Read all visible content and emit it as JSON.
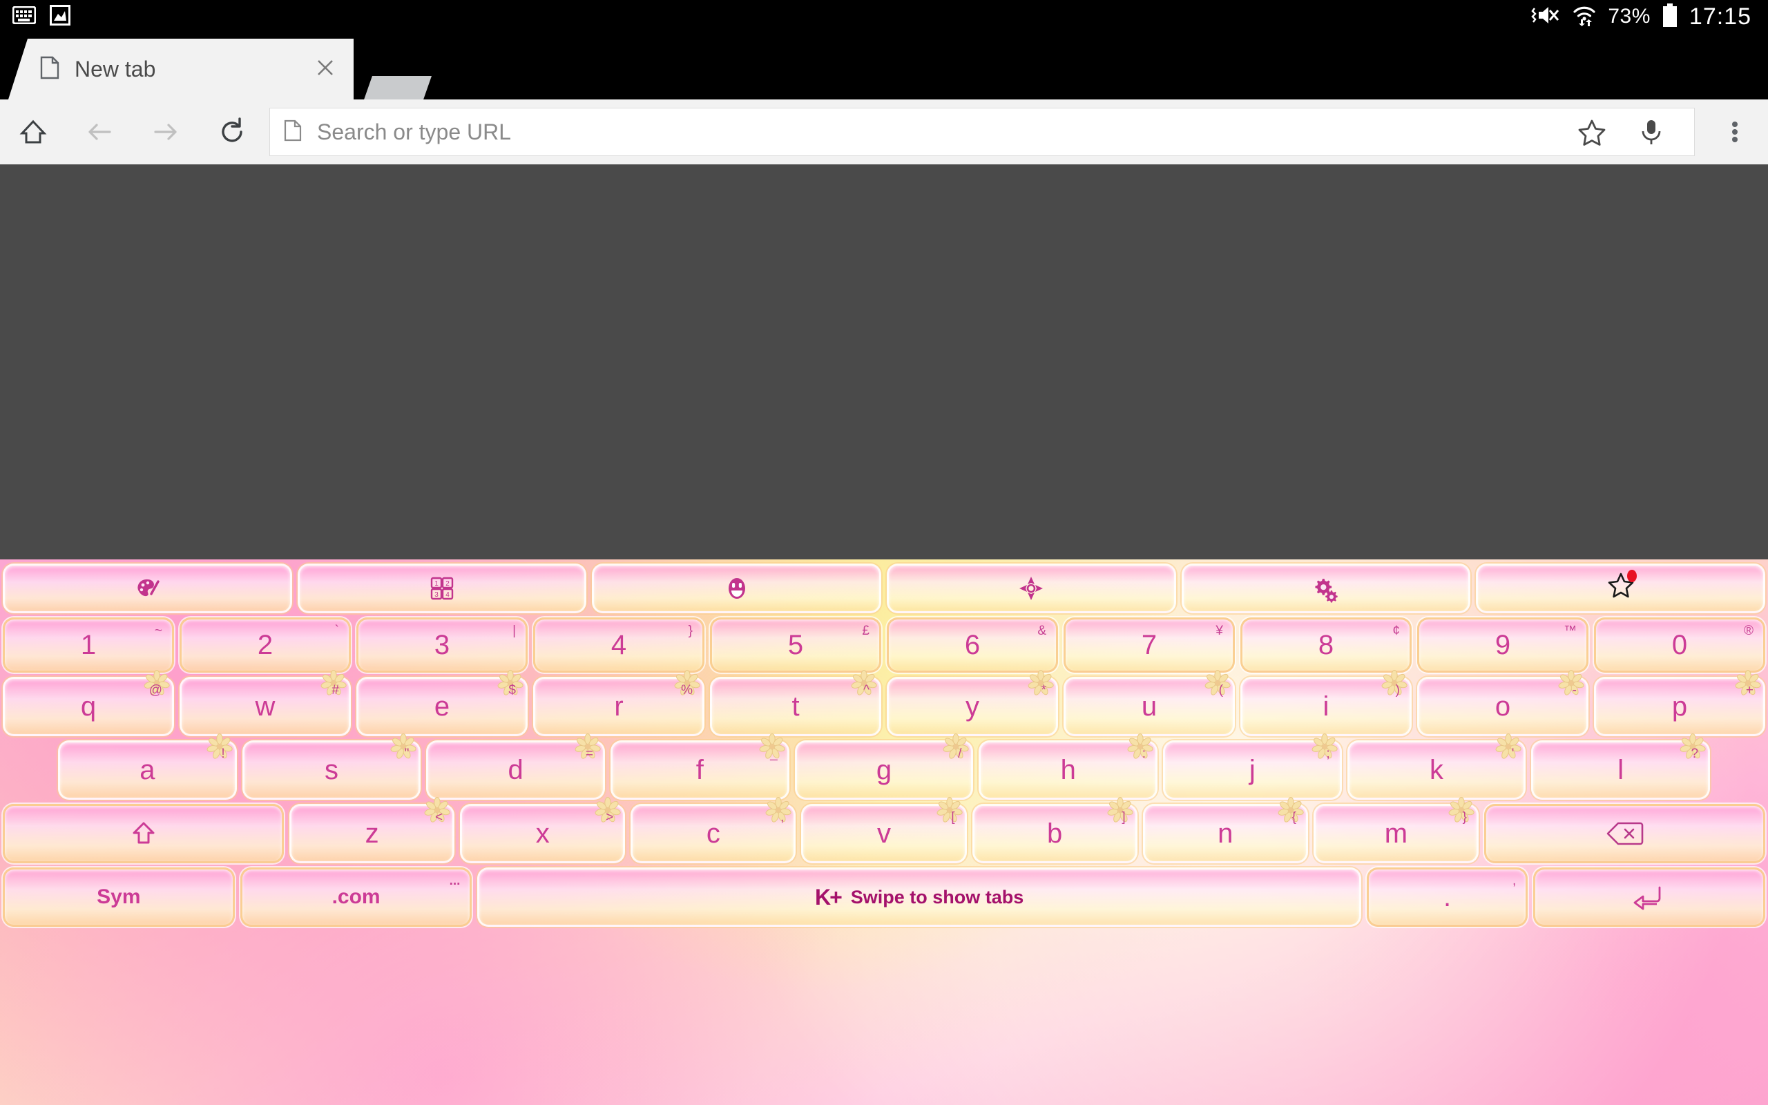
{
  "statusbar": {
    "left_icons": [
      "keyboard-icon",
      "image-icon"
    ],
    "battery_percent": "73%",
    "clock": "17:15",
    "right_icons": [
      "vibrate-mute-icon",
      "wifi-icon",
      "battery-icon"
    ]
  },
  "tabstrip": {
    "tabs": [
      {
        "title": "New tab",
        "favicon": "page-icon",
        "close": "close-icon",
        "active": true
      }
    ],
    "background_tab_present": true
  },
  "toolbar": {
    "home_label": "home-icon",
    "back_label": "back-arrow-icon",
    "forward_label": "forward-arrow-icon",
    "reload_label": "reload-icon",
    "omnibox": {
      "favicon": "page-icon",
      "placeholder": "Search or type URL",
      "value": "",
      "bookmark_icon": "star-icon",
      "voice_icon": "microphone-icon"
    },
    "menu_icon": "overflow-menu-icon"
  },
  "keyboard": {
    "function_row": [
      {
        "id": "theme",
        "icon": "palette-icon"
      },
      {
        "id": "numpad",
        "icon": "number-grid-icon"
      },
      {
        "id": "emoji",
        "icon": "smiley-icon"
      },
      {
        "id": "cursor",
        "icon": "four-arrows-icon"
      },
      {
        "id": "settings",
        "icon": "gears-icon"
      },
      {
        "id": "favorite",
        "icon": "star-badge-icon",
        "badge": true
      }
    ],
    "number_row": [
      {
        "label": "1",
        "sup": "~"
      },
      {
        "label": "2",
        "sup": "`"
      },
      {
        "label": "3",
        "sup": "|"
      },
      {
        "label": "4",
        "sup": "}"
      },
      {
        "label": "5",
        "sup": "£"
      },
      {
        "label": "6",
        "sup": "&"
      },
      {
        "label": "7",
        "sup": "¥"
      },
      {
        "label": "8",
        "sup": "¢"
      },
      {
        "label": "9",
        "sup": "™"
      },
      {
        "label": "0",
        "sup": "®"
      }
    ],
    "row_q": [
      {
        "label": "q",
        "sup": "@"
      },
      {
        "label": "w",
        "sup": "#"
      },
      {
        "label": "e",
        "sup": "$"
      },
      {
        "label": "r",
        "sup": "%"
      },
      {
        "label": "t",
        "sup": "^"
      },
      {
        "label": "y",
        "sup": "*"
      },
      {
        "label": "u",
        "sup": "("
      },
      {
        "label": "i",
        "sup": ")"
      },
      {
        "label": "o",
        "sup": "-"
      },
      {
        "label": "p",
        "sup": "+"
      }
    ],
    "row_a": [
      {
        "label": "a",
        "sup": "!"
      },
      {
        "label": "s",
        "sup": "\""
      },
      {
        "label": "d",
        "sup": "="
      },
      {
        "label": "f",
        "sup": "_"
      },
      {
        "label": "g",
        "sup": "/"
      },
      {
        "label": "h",
        "sup": ":"
      },
      {
        "label": "j",
        "sup": ";"
      },
      {
        "label": "k",
        "sup": "'"
      },
      {
        "label": "l",
        "sup": "?"
      }
    ],
    "row_z": [
      {
        "label": "shift-icon",
        "type": "shift"
      },
      {
        "label": "z",
        "sup": "<"
      },
      {
        "label": "x",
        "sup": ">"
      },
      {
        "label": "c",
        "sup": ","
      },
      {
        "label": "v",
        "sup": "["
      },
      {
        "label": "b",
        "sup": "]"
      },
      {
        "label": "n",
        "sup": "{"
      },
      {
        "label": "m",
        "sup": "}"
      },
      {
        "label": "backspace-icon",
        "type": "backspace"
      }
    ],
    "bottom_row": {
      "sym_label": "Sym",
      "com_label": ".com",
      "com_sup": "...",
      "space_brand": "K+",
      "space_hint": "Swipe to show tabs",
      "dot_label": ".",
      "dot_sup": ",",
      "enter_label": "enter-icon"
    }
  },
  "colors": {
    "key_text": "#cc3b96",
    "key_border": "#facd8c",
    "brand_magenta": "#a4116b",
    "badge_red": "#e81123",
    "page_background": "#4a4a4a",
    "toolbar_background": "#f2f2f2",
    "status_background": "#000000"
  }
}
